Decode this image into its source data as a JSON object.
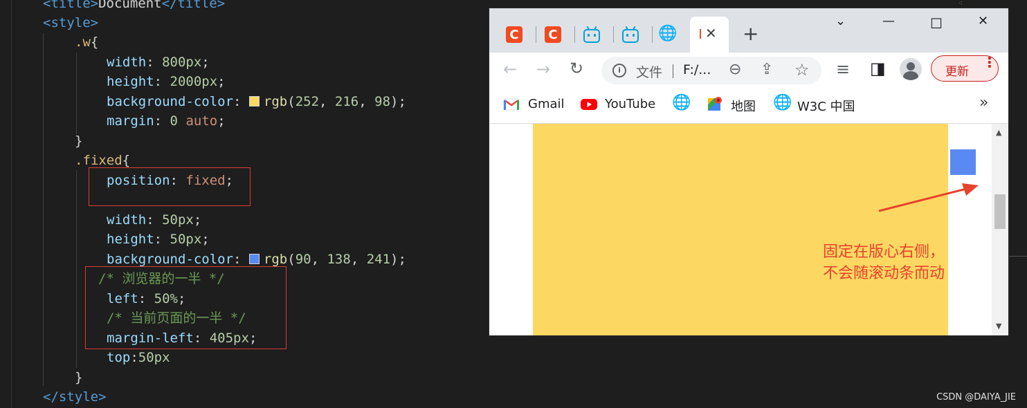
{
  "editor": {
    "lines": [
      {
        "html": "<span class='tag'>&lt;title&gt;</span>Document<span class='tag'>&lt;/title&gt;</span>"
      },
      {
        "html": "<span class='tag'>&lt;style&gt;</span>"
      },
      {
        "html": "<span class='sel'>.w</span>{"
      },
      {
        "html": "<span class='prop'>width</span>: <span class='num'>800px</span>;"
      },
      {
        "html": "<span class='prop'>height</span>: <span class='num'>2000px</span>;"
      },
      {
        "html": "<span class='prop'>background-color</span>: <span class='swatch' style='background:rgb(252,216,98)'></span><span class='fn'>rgb</span>(<span class='num'>252</span>, <span class='num'>216</span>, <span class='num'>98</span>);"
      },
      {
        "html": "<span class='prop'>margin</span>: <span class='num'>0</span> <span class='kw'>auto</span>;"
      },
      {
        "html": "}"
      },
      {
        "html": "<span class='sel'>.fixed</span>{"
      },
      {
        "html": "<span class='prop'>position</span>: <span class='kw'>fixed</span>;"
      },
      {
        "html": ""
      },
      {
        "html": "<span class='prop'>width</span>: <span class='num'>50px</span>;"
      },
      {
        "html": "<span class='prop'>height</span>: <span class='num'>50px</span>;"
      },
      {
        "html": "<span class='prop'>background-color</span>: <span class='swatch' style='background:rgb(90,138,241)'></span><span class='fn'>rgb</span>(<span class='num'>90</span>, <span class='num'>138</span>, <span class='num'>241</span>);"
      },
      {
        "html": "<span class='comment'>/* 浏览器的一半 */</span>"
      },
      {
        "html": "<span class='prop'>left</span>: <span class='num'>50%</span>;"
      },
      {
        "html": "<span class='comment'>/* 当前页面的一半 */</span>"
      },
      {
        "html": "<span class='prop'>margin-left</span>: <span class='num'>405px</span>;"
      },
      {
        "html": "<span class='prop'>top</span>:<span class='num'>50px</span>"
      },
      {
        "html": "}"
      },
      {
        "html": "<span class='tag'>&lt;/style&gt;</span>"
      }
    ]
  },
  "browser": {
    "tabs": [
      {
        "icon": "csdn-icon",
        "label": "C"
      },
      {
        "icon": "csdn-icon",
        "label": "C"
      },
      {
        "icon": "bilibili-icon"
      },
      {
        "icon": "bilibili-icon"
      },
      {
        "icon": "globe-icon",
        "label": "🌐"
      }
    ],
    "active_tab_close": "✕",
    "new_tab": "+",
    "window_controls": {
      "chevron": "⌄",
      "minimize": "—",
      "maximize": "☐",
      "close": "✕"
    },
    "toolbar": {
      "back": "←",
      "forward": "→",
      "reload": "↻",
      "omnibox_info": "i",
      "omnibox_file": "文件",
      "omnibox_url": "F:/...",
      "zoom": "⊖",
      "share": "⇪",
      "star": "☆",
      "media": "≡",
      "sidepanel": "◨",
      "update_label": "更新",
      "update_menu": "⋮"
    },
    "bookmarks": {
      "gmail": "Gmail",
      "youtube": "YouTube",
      "maps": "地图",
      "w3c": "W3C 中国",
      "more": "»"
    },
    "page": {
      "annotation": "固定在版心右侧，\n不会随滚动条而动"
    },
    "scroll_up": "▲",
    "scroll_down": "▼"
  },
  "watermark": "CSDN @DAIYA_JIE",
  "colors": {
    "yellow": "rgb(252, 216, 98)",
    "blue": "rgb(90, 138, 241)",
    "annotation_red": "#e8412c"
  }
}
